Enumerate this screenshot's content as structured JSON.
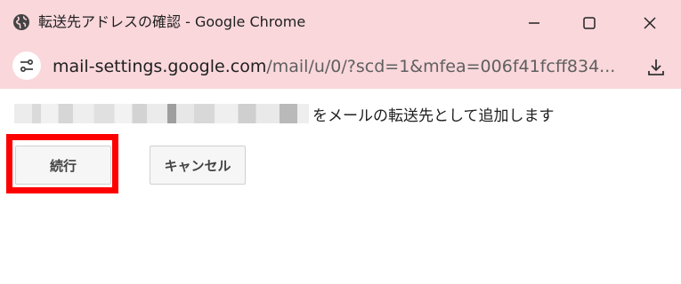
{
  "window": {
    "title": "転送先アドレスの確認 - Google Chrome",
    "title_bar_color": "#f9d7db"
  },
  "address_bar": {
    "url_domain": "mail-settings.google.com",
    "url_path": "/mail/u/0/?scd=1&mfea=006f41fcff834..."
  },
  "icons": {
    "globe": "globe-icon",
    "minimize": "minimize-icon",
    "maximize": "maximize-icon",
    "close": "close-icon",
    "site_info": "tune-icon",
    "download": "download-icon"
  },
  "content": {
    "message": "をメールの転送先として追加します",
    "continue_label": "続行",
    "cancel_label": "キャンセル",
    "highlight_color": "#ff0000"
  }
}
